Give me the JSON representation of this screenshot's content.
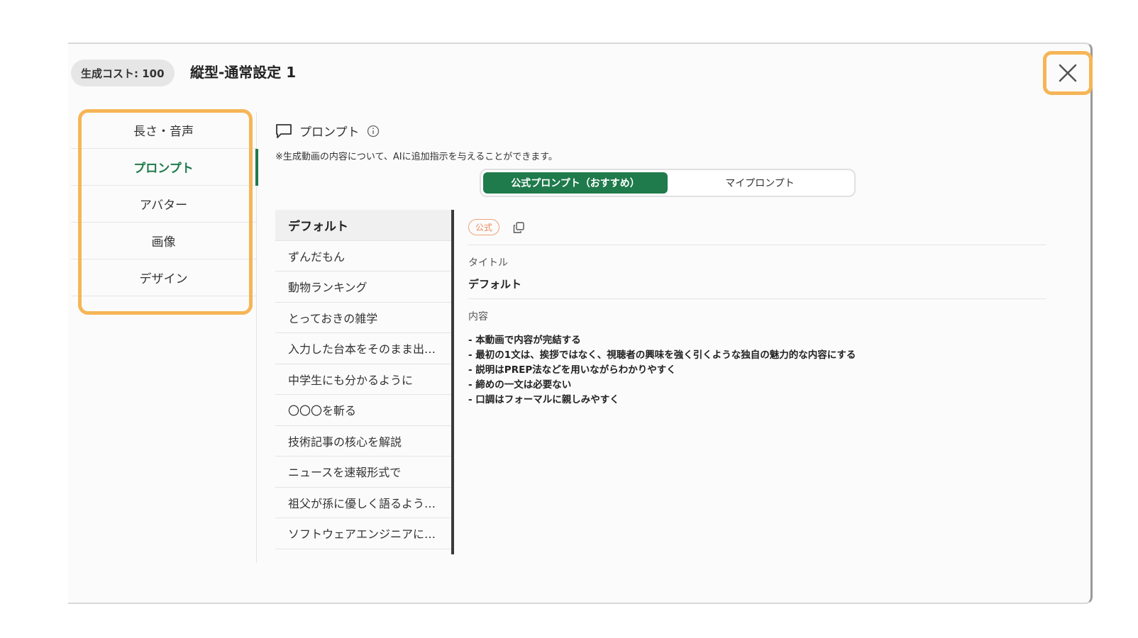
{
  "header": {
    "cost_label": "生成コスト: 100",
    "title": "縦型-通常設定 1",
    "close_icon": "close-icon"
  },
  "sidebar": {
    "items": [
      {
        "label": "長さ・音声"
      },
      {
        "label": "プロンプト",
        "active": true
      },
      {
        "label": "アバター"
      },
      {
        "label": "画像"
      },
      {
        "label": "デザイン"
      }
    ]
  },
  "section": {
    "title": "プロンプト",
    "note": "※生成動画の内容について、AIに追加指示を与えることができます。"
  },
  "tabs": {
    "official": "公式プロンプト（おすすめ）",
    "mine": "マイプロンプト"
  },
  "prompt_list": [
    "デフォルト",
    "ずんだもん",
    "動物ランキング",
    "とっておきの雑学",
    "入力した台本をそのまま出…",
    "中学生にも分かるように",
    "〇〇〇を斬る",
    "技術記事の核心を解説",
    "ニュースを速報形式で",
    "祖父が孫に優しく語るよう…",
    "ソフトウェアエンジニアに…"
  ],
  "detail": {
    "badge": "公式",
    "title_label": "タイトル",
    "title_value": "デフォルト",
    "content_label": "内容",
    "content_lines": [
      "- 本動画で内容が完結する",
      "- 最初の1文は、挨拶ではなく、視聴者の興味を強く引くような独自の魅力的な内容にする",
      "- 説明はPREP法などを用いながらわかりやすく",
      "- 締めの一文は必要ない",
      "- 口調はフォーマルに親しみやすく"
    ]
  },
  "colors": {
    "accent": "#1f7a4c",
    "highlight": "#f6b556",
    "badge": "#f08a5a"
  }
}
